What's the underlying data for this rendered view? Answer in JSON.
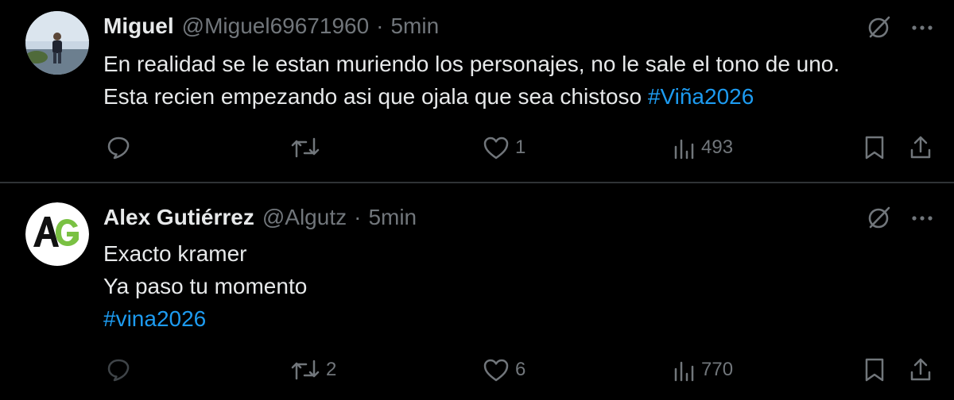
{
  "tweets": [
    {
      "author_name": "Miguel",
      "handle": "@Miguel69671960",
      "separator": "·",
      "time": "5min",
      "lines": [
        {
          "text": "En realidad se le estan muriendo los personajes, no le sale el tono de uno.",
          "hashtag": ""
        },
        {
          "text": "Esta recien empezando asi que ojala que sea chistoso ",
          "hashtag": "#Viña2026"
        }
      ],
      "actions": {
        "replies": "",
        "reposts": "",
        "likes": "1",
        "views": "493"
      }
    },
    {
      "author_name": "Alex Gutiérrez",
      "handle": "@Algutz",
      "separator": "·",
      "time": "5min",
      "lines": [
        {
          "text": "Exacto kramer",
          "hashtag": ""
        },
        {
          "text": "Ya paso tu momento",
          "hashtag": ""
        },
        {
          "text": "",
          "hashtag": "#vina2026"
        }
      ],
      "actions": {
        "replies": "",
        "reposts": "2",
        "likes": "6",
        "views": "770"
      }
    }
  ],
  "avatar2_logo_text": "AG",
  "icons": [
    "grok-icon",
    "more-icon",
    "reply-icon",
    "repost-icon",
    "like-icon",
    "views-icon",
    "bookmark-icon",
    "share-icon"
  ],
  "colors": {
    "background": "#000000",
    "text": "#e7e9ea",
    "secondary": "#71767b",
    "accent": "#1d9bf0",
    "divider": "#2f3336"
  }
}
